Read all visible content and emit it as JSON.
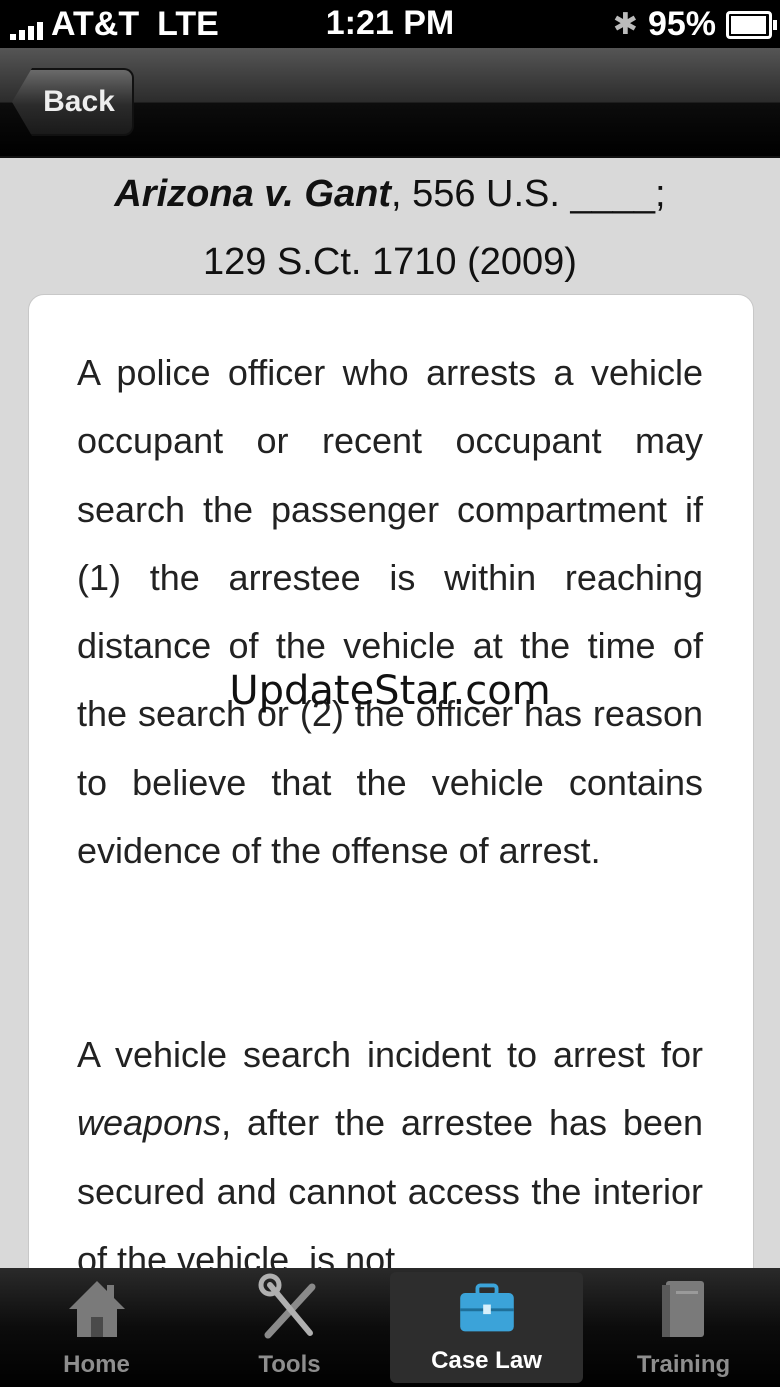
{
  "status_bar": {
    "carrier": "AT&T",
    "network": "LTE",
    "time": "1:21 PM",
    "battery": "95%"
  },
  "nav": {
    "back_label": "Back"
  },
  "case": {
    "name": "Arizona v. Gant",
    "citation_line1": ", 556 U.S. ____;",
    "citation_line2": "129 S.Ct. 1710 (2009)"
  },
  "content": {
    "para1": "A police officer who arrests a vehicle occupant or recent occupant may search the passenger compartment if (1) the arrestee is within reaching distance of the vehicle at the time of the search or (2) the officer has reason to believe that the vehicle contains evidence of the offense of arrest.",
    "para2_before": "A vehicle search incident to arrest for ",
    "para2_italic": "weapons",
    "para2_after": ", after the arrestee has been secured and cannot access the interior of the vehicle, is not"
  },
  "watermark": "UpdateStar.com",
  "tabs": [
    {
      "label": "Home",
      "icon": "house-icon"
    },
    {
      "label": "Tools",
      "icon": "tools-icon"
    },
    {
      "label": "Case Law",
      "icon": "briefcase-icon"
    },
    {
      "label": "Training",
      "icon": "book-icon"
    }
  ],
  "active_tab": "Case Law",
  "colors": {
    "nav_bar": "#1a1a1a",
    "background": "#d9d9d9",
    "active_icon": "#3ba3d9"
  }
}
